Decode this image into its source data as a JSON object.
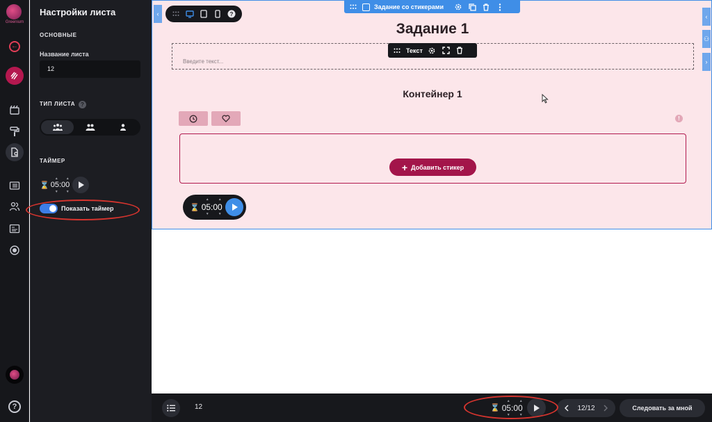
{
  "rail": {
    "brand": "Greenium"
  },
  "panel": {
    "title": "Настройки листа",
    "section_main": "Основные",
    "name_label": "Название листа",
    "name_value": "12",
    "section_type": "Тип листа",
    "help_glyph": "?",
    "section_timer": "Таймер",
    "timer_value": "05:00",
    "show_timer_label": "Показать таймер",
    "show_timer_on": true
  },
  "canvas": {
    "block_label": "Задание со стикерами",
    "task_title": "Задание 1",
    "text_placeholder": "Введите текст...",
    "text_toolbar_label": "Текст",
    "container_title": "Контейнер 1",
    "info_glyph": "!",
    "add_sticker_label": "Добавить стикер",
    "timer_value": "05:00"
  },
  "bottom": {
    "page_number": "12",
    "timer_value": "05:00",
    "pager": "12/12",
    "follow_label": "Следовать за мной"
  },
  "icons": [
    "grid-dots-icon",
    "monitor-icon",
    "tablet-icon",
    "phone-icon",
    "help-icon",
    "gear-icon",
    "copy-icon",
    "trash-icon",
    "more-icon",
    "expand-icon",
    "clock-icon",
    "heart-icon",
    "info-icon",
    "plus-icon",
    "hourglass-icon",
    "play-icon",
    "list-icon",
    "chevron-left-icon",
    "chevron-right-icon",
    "people-icon",
    "group-icon",
    "person-icon"
  ],
  "colors": {
    "accent_blue": "#3f8ee7",
    "brand_crimson": "#a3154a",
    "sheet_pink": "#fce6ea",
    "sidebar_dark": "#1c1d22",
    "annotation_red": "#d5342e"
  }
}
